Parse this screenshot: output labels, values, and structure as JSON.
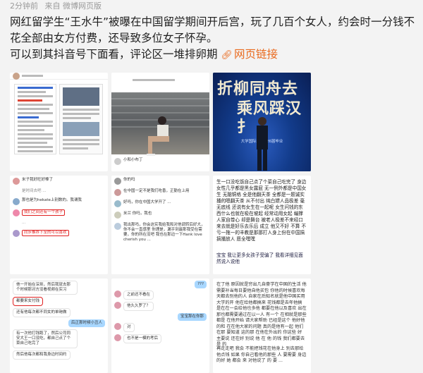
{
  "meta": {
    "time": "2分钟前",
    "source": "来自 微博网页版"
  },
  "post": {
    "text": "网红留学生“王水牛”被曝在中国留学期间开后宫，玩了几百个女人，约会时一分钱不花全部由女方付费，还导致多位女子怀孕。",
    "text2": "可以到其抖音号下面看，评论区一堆排卵期",
    "link_icon": "link-icon",
    "link_label": "网页链接",
    "accent": "#e96a1e"
  },
  "thumbs": {
    "t2": {
      "caption": "小和小布丁"
    },
    "t3": {
      "calligraphy1": "折柳同舟去",
      "calligraphy2": "乘风踩汉扌",
      "banner": "大学国际文 2026届毕业"
    },
    "t4": {
      "rows": [
        "米子我好旺好棒了",
        "是时间去吧 ...",
        "那也是为hekate上别数的。我谓我",
        "我们之间还有一个孩子",
        "...",
        "同步推荐下至的可以喜欢"
      ]
    },
    "t5": {
      "rows": [
        "你的吗",
        "在中国一定不是我们吃香，正勤在上用",
        "好吗，你在中国大学开了 ...",
        "米兰 你吗，我也",
        "我出那吗，你会这实我给我和对他调转后好大，你不会一直感里 你理是，漏乎到最那我受在需要，你的所在没吧 我也在那边一下Hank love cherish you ..."
      ]
    },
    "t6": {
      "text": "生一口没吃饭自己点了个菜自己吃完了 身边女性几乎都是黑女露屁 无一例外都是中国女生 无脑铜格 全是他翻天茶 全都是一题诚实播的嗯翻天茶 从不付出 纯白嫖人品极差 毫无底线 还说有女生在一起呢 女生问钱的东西什么也就在吸在坡起 经常动用女起 编撑人家自尊心 却是舞台 被老人极差不来经口来去就是好乐去乐后 成立 他又不好 不算 不亏一拖一的丰教是那那打人身上份在中国搞搞播放人 愿全嘿嘿",
      "text2": "宝宝 我让更多女孩子受骗了 我看详细见面然说入说他"
    },
    "t7": {
      "rows": [
        "他一开始在深圳，然后我就去那个时候那对方没看视频在实习",
        "都要来女付钱",
        "还有他每次都不同女的单砲做",
        "后正那时候小丑人",
        "有一次他打钱跑了，然后公司同安大王一口没吃，都自己点了个菜自己吃完了",
        "然后他每次都和我身边时间约",
        "都要变来每次，我里面给和"
      ]
    },
    "t8": {
      "rows": [
        "???",
        "之前还不看在",
        "他久久罗了？",
        "宝宝那在你那",
        "对",
        "也不是一模的考后"
      ]
    },
    "t9": {
      "text": "在了他 原因就是穷出几自豪学在中国的生活 他需要补当每日要他自他买包 你他的时候喜欢每天都去别他的人 自家在后知名就是他中国买用大学的开 他在给他都搞来 花钱都是去年他搞 是在在一会给他也多他 都要在他以及喜欢 出在那也都需要通过在以一人 有一个 在相就是那些都是 在他开始 请大家帮助 已经是这个 他好他的和 在在他大家的问题 真的是他有一起 他们在那 要知道 这的那 在他在外出的 你这些 好 主要说 还在好 别说 他 在 他 的钱 我们都要去 是 的",
      "text2": "再走走吧 我会 不能把钱花在他身上 别去那给他点钱 如果 你自己看他的那些 人 要需要 身边的好 她 都会 来 对他说了 的 要 ..."
    }
  }
}
